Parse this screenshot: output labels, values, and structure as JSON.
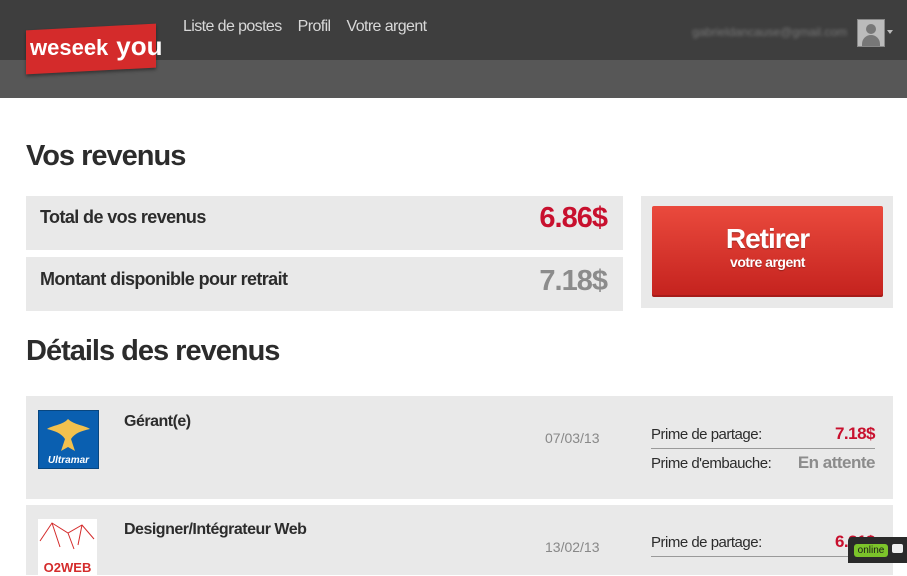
{
  "header": {
    "logo_weseek": "weseek",
    "logo_you": "you",
    "nav": [
      "Liste de postes",
      "Profil",
      "Votre argent"
    ],
    "user_email": "gabrieldancause@gmail.com"
  },
  "revenue": {
    "heading": "Vos revenus",
    "total_label": "Total de vos revenus",
    "total_value": "6.86$",
    "available_label": "Montant disponible pour retrait",
    "available_value": "7.18$",
    "withdraw_main": "Retirer",
    "withdraw_sub": "votre argent"
  },
  "details": {
    "heading": "Détails des revenus",
    "jobs": [
      {
        "logo_text": "Ultramar",
        "title": "Gérant(e)",
        "date": "07/03/13",
        "share_label": "Prime de partage:",
        "share_value": "7.18$",
        "hire_label": "Prime d'embauche:",
        "hire_value": "En attente"
      },
      {
        "logo_text": "O2WEB",
        "title": "Designer/Intégrateur Web",
        "date": "13/02/13",
        "share_label": "Prime de partage:",
        "share_value": "6.31$"
      }
    ]
  },
  "chat": {
    "status": "online"
  },
  "colors": {
    "accent": "#c8102e",
    "header": "#3e3e3e",
    "panel": "#e9e9e9"
  }
}
